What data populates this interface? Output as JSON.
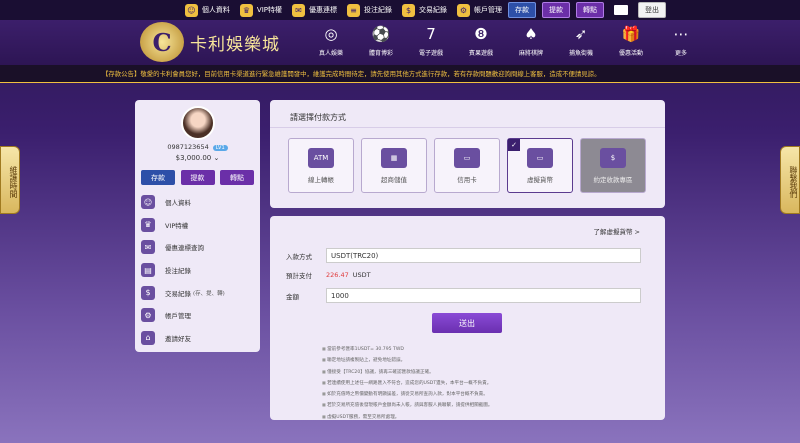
{
  "topbar": {
    "items": [
      {
        "label": "個人資料",
        "icon": "user-icon"
      },
      {
        "label": "VIP特權",
        "icon": "crown-icon"
      },
      {
        "label": "優惠連標",
        "icon": "gift-icon"
      },
      {
        "label": "投注紀錄",
        "icon": "list-icon"
      },
      {
        "label": "交易紀錄",
        "icon": "transaction-icon"
      },
      {
        "label": "帳戶管理",
        "icon": "gear-icon"
      }
    ],
    "deposit": "存款",
    "withdraw": "提款",
    "transfer": "轉點",
    "logout": "登出"
  },
  "header": {
    "logo_text": "卡利娛樂城",
    "logo_letter": "C",
    "nav": [
      {
        "label": "真人娛樂",
        "icon": "poker-chip-icon",
        "glyph": "◎"
      },
      {
        "label": "體育博彩",
        "icon": "soccer-ball-icon",
        "glyph": "⚽"
      },
      {
        "label": "電子遊戲",
        "icon": "slot-seven-icon",
        "glyph": "7"
      },
      {
        "label": "賓果遊戲",
        "icon": "bingo-ball-icon",
        "glyph": "❽"
      },
      {
        "label": "麻將棋牌",
        "icon": "cards-icon",
        "glyph": "♠"
      },
      {
        "label": "捕魚街機",
        "icon": "fish-icon",
        "glyph": "➶"
      },
      {
        "label": "優惠活動",
        "icon": "gift-icon",
        "glyph": "🎁"
      },
      {
        "label": "更多",
        "icon": "more-icon",
        "glyph": "⋯"
      }
    ]
  },
  "announcement": "【存款公告】敬愛的卡利會員您好，目前信用卡渠道進行緊急維護開發中，維護完成時間待定，請先使用其他方式進行存款，若有存款問題歡迎詢問線上客服，造成不便請見諒。",
  "side_tabs": {
    "left": "維護時間",
    "right": "聯繫我們"
  },
  "profile": {
    "phone": "0987123654",
    "level": "LV1",
    "balance": "$3,000.00",
    "deposit": "存款",
    "withdraw": "提款",
    "transfer": "轉點"
  },
  "menu": [
    {
      "label": "個人資料",
      "sub": "",
      "icon": "user-icon"
    },
    {
      "label": "VIP特權",
      "sub": "",
      "icon": "crown-icon"
    },
    {
      "label": "優惠連標查詢",
      "sub": "",
      "icon": "gift-icon"
    },
    {
      "label": "投注紀錄",
      "sub": "",
      "icon": "document-icon"
    },
    {
      "label": "交易紀錄",
      "sub": "(存、提、轉)",
      "icon": "transaction-icon"
    },
    {
      "label": "帳戶管理",
      "sub": "",
      "icon": "gear-icon"
    },
    {
      "label": "邀請好友",
      "sub": "",
      "icon": "invite-icon"
    }
  ],
  "payment": {
    "title": "請選擇付款方式",
    "methods": [
      {
        "label": "線上轉帳",
        "icon_text": "ATM",
        "icon": "atm-icon"
      },
      {
        "label": "超商儲值",
        "icon_text": "▦",
        "icon": "store-icon"
      },
      {
        "label": "信用卡",
        "icon_text": "▭",
        "icon": "credit-card-icon"
      },
      {
        "label": "虛擬貨幣",
        "icon_text": "▭",
        "icon": "virtual-currency-icon",
        "selected": true
      },
      {
        "label": "約定收款專區",
        "icon_text": "$",
        "icon": "agreed-payment-icon",
        "disabled": true
      }
    ]
  },
  "form": {
    "learn_link": "了解虛擬貨幣 >",
    "method_label": "入款方式",
    "method_value": "USDT(TRC20)",
    "estimate_label": "預計支付",
    "estimate_value": "226.47",
    "estimate_unit": "USDT",
    "amount_label": "金額",
    "amount_value": "1000",
    "submit": "送出",
    "notes": [
      "當前參考匯率1USDT= 30.795 TWD",
      "聯定地址請複製貼上，避免地址錯誤。",
      "僅接受【TRC20】協議，請再三確認匯款協議正確。",
      "若連續使用上述任一網路匯入不符合，造成您的USDT遺失，本平台一概不負責。",
      "如於充值時之幣價變動有明顯誤差，請從交易所查詢入款，對本平台概不負責。",
      "若於交易所充值後發現帳戶金額尚未入帳，請與客服人員聯繫，請提供相關截圖。",
      "虛擬USDT服務，需至交易所處理。"
    ]
  }
}
